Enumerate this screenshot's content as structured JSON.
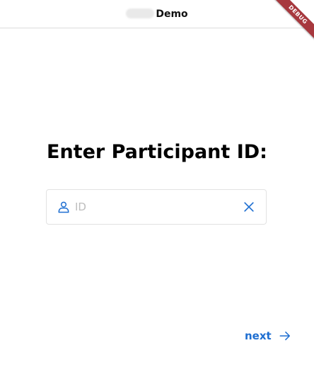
{
  "appbar": {
    "title": "Demo",
    "debug_label": "DEBUG"
  },
  "main": {
    "heading": "Enter Participant ID:",
    "id_field": {
      "placeholder": "ID",
      "value": ""
    },
    "next_label": "next"
  },
  "icons": {
    "person": "person-outline-icon",
    "clear": "close-icon",
    "next": "arrow-right-icon"
  },
  "colors": {
    "accent": "#1f6fd1",
    "debug_banner": "#a7383e"
  }
}
